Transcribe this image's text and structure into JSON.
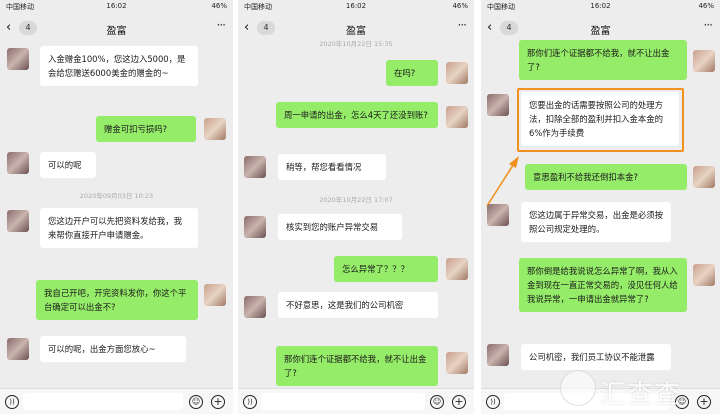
{
  "colors": {
    "bg": "#ededed",
    "green_bubble": "#95ec69",
    "white_bubble": "#ffffff",
    "highlight": "#f0901e"
  },
  "panels": [
    {
      "status": {
        "carrier": "中国移动",
        "time": "16:02",
        "battery": "46%"
      },
      "nav": {
        "badge": "4",
        "title": "盈富"
      },
      "messages": [
        {
          "text": "入金赠金100%，您这边入5000，是会给您赠送6000美金的赠金的~"
        },
        {
          "text": "赠金可扣亏损吗?"
        },
        {
          "text": "可以的呢"
        },
        {
          "text": "您这边开户可以先把资料发给我，我来帮你直接开户申请赠金。"
        },
        {
          "text": "我自己开吧，开完资料发你，你这个平台确定可以出金不?"
        },
        {
          "text": "可以的呢，出金方面您放心~"
        }
      ],
      "timestamps": [
        "2020年09月03日 10:23"
      ]
    },
    {
      "status": {
        "carrier": "中国移动",
        "time": "16:02",
        "battery": "46%"
      },
      "nav": {
        "badge": "4",
        "title": "盈富"
      },
      "messages": [
        {
          "text": "在吗?"
        },
        {
          "text": "周一申请的出金，怎么4天了还没到账?"
        },
        {
          "text": "稍等，帮您看看情况"
        },
        {
          "text": "核实到您的账户异常交易"
        },
        {
          "text": "怎么异常了？？？"
        },
        {
          "text": "不好意思，这是我们的公司机密"
        },
        {
          "text": "那你们连个证据都不给我，就不让出金了?"
        }
      ],
      "timestamps": [
        "2020年10月22日 15:35",
        "2020年10月22日 17:07"
      ]
    },
    {
      "status": {
        "carrier": "中国移动",
        "time": "16:02",
        "battery": "46%"
      },
      "nav": {
        "badge": "4",
        "title": "盈富"
      },
      "messages": [
        {
          "text": "那你们连个证据都不给我，就不让出金了?"
        },
        {
          "text": "您要出金的话需要按照公司的处理方法，扣除全部的盈利并扣入金本金的6%作为手续费"
        },
        {
          "text": "意思盈利不给我还倒扣本金?"
        },
        {
          "text": "您这边属于异常交易，出金是必须按照公司规定处理的。"
        },
        {
          "text": "那你倒是给我说说怎么异常了啊，我从入金到现在一直正常交易的，没见任何人给我说异常，一申请出金就异常了?"
        },
        {
          "text": "公司机密，我们员工协议不能泄露"
        }
      ]
    }
  ],
  "watermark": {
    "text": "汇查查"
  }
}
